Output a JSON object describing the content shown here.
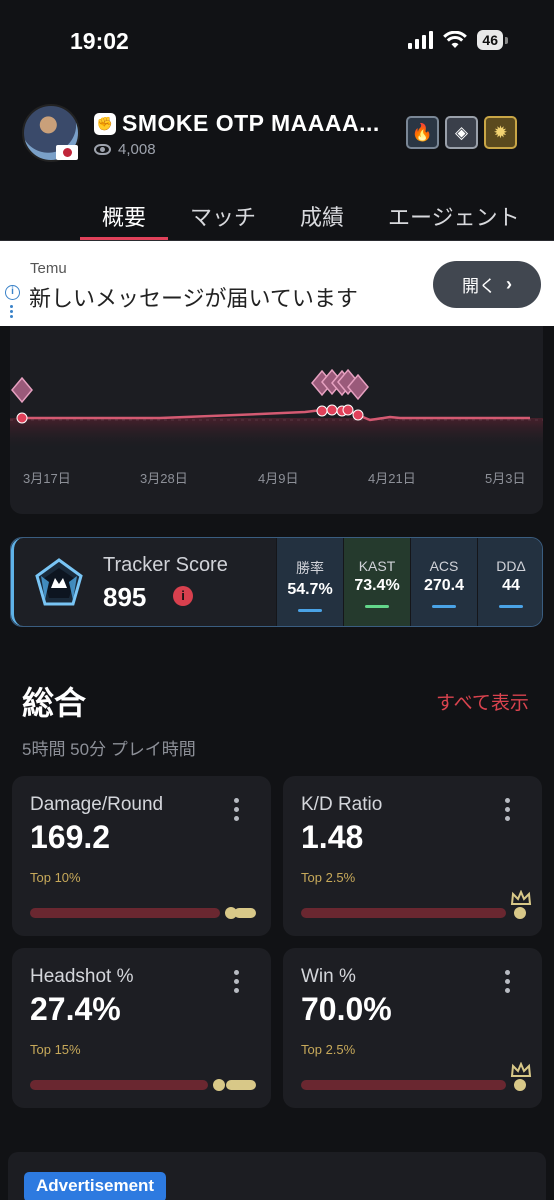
{
  "status": {
    "time": "19:02",
    "battery": "46"
  },
  "profile": {
    "username": "SMOKE OTP MAAAA...",
    "views": "4,008"
  },
  "tabs": [
    "概要",
    "マッチ",
    "成績",
    "エージェント"
  ],
  "ad": {
    "source": "Temu",
    "message": "新しいメッセージが届いています",
    "open_label": "開く"
  },
  "chart_data": {
    "type": "line",
    "x_ticks": [
      "3月17日",
      "3月28日",
      "4月9日",
      "4月21日",
      "5月3日"
    ],
    "series": [
      {
        "values": [
          0,
          0,
          0,
          0,
          0,
          0,
          0,
          0,
          1,
          2,
          1,
          0,
          0,
          0,
          0,
          0
        ]
      }
    ],
    "grid": true
  },
  "tracker": {
    "label": "Tracker Score",
    "value": "895",
    "stats": [
      {
        "label": "勝率",
        "value": "54.7%",
        "color": "#4aa3e6"
      },
      {
        "label": "KAST",
        "value": "73.4%",
        "color": "#63d68a"
      },
      {
        "label": "ACS",
        "value": "270.4",
        "color": "#4aa3e6"
      },
      {
        "label": "DDΔ",
        "value": "44",
        "color": "#4aa3e6"
      }
    ]
  },
  "overview": {
    "title": "総合",
    "show_all": "すべて表示",
    "playtime": "5時間 50分 プレイ時間",
    "cards": [
      {
        "name": "Damage/Round",
        "value": "169.2",
        "rank": "Top 10%"
      },
      {
        "name": "K/D Ratio",
        "value": "1.48",
        "rank": "Top 2.5%"
      },
      {
        "name": "Headshot %",
        "value": "27.4%",
        "rank": "Top 15%"
      },
      {
        "name": "Win %",
        "value": "70.0%",
        "rank": "Top 2.5%"
      }
    ]
  },
  "advertisement_label": "Advertisement",
  "colors": {
    "accent": "#e0415a",
    "gold": "#c7a95a",
    "blue": "#4aa3e6"
  }
}
